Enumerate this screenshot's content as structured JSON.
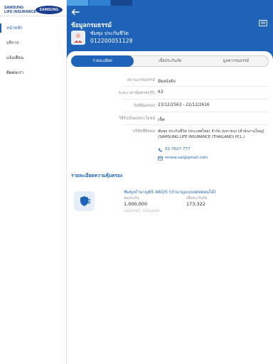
{
  "brand": {
    "line1": "SAMSUNG",
    "line2": "LIFE INSURANCE",
    "badge": "SAMSUNG",
    "color_primary": "#1f63b8",
    "color_logo": "#1a3d8f"
  },
  "sidebar": {
    "items": [
      {
        "label": "หน้าหลัก",
        "active": true
      },
      {
        "label": "บริการ",
        "active": false
      },
      {
        "label": "แจ้งเตือน",
        "active": false
      },
      {
        "label": "ติดต่อเรา",
        "active": false
      }
    ]
  },
  "header": {
    "title": "ข้อมูลกรมธรรม์",
    "holder_name": "ซัมซุง ประกันชีวิต",
    "policy_number": "012200051128",
    "back_icon": "arrow-left-icon",
    "card_icon": "id-card-icon"
  },
  "tabs": [
    {
      "label": "รายละเอียด",
      "active": true
    },
    {
      "label": "เบี้ยประกันภัย",
      "active": false
    },
    {
      "label": "มูลค่ากรมธรรม์",
      "active": false
    }
  ],
  "details": [
    {
      "label": "สถานะกรมธรรม์",
      "value": "มีผลบังคับ"
    },
    {
      "label": "ระยะเวลาคุ้มครอง(ปี)",
      "value": "63"
    },
    {
      "label": "วันที่คุ้มครอง",
      "value": "23/12/2563 - 22/12/2616"
    },
    {
      "label": "วิธีรับเงินผลประโยชน์",
      "value": "เช็ค"
    },
    {
      "label": "บริษัทที่ติดต่อ",
      "value_line1": "ซัมซุง ประกันชีวิต (ประเทศไทย) จำกัด (มหาชน) (สำนักงานใหญ่)",
      "value_line2": "(SAMSUNG LIFE INSURANCE (THAILAND) PCL.)"
    }
  ],
  "contact": {
    "phone": "02-7627-777",
    "email": "renew.sal@gmail.com",
    "phone_icon": "phone-icon",
    "email_icon": "email-icon"
  },
  "coverage": {
    "section_title": "รายละเอียดความคุ้มครอง",
    "icon": "shield-coverage-icon",
    "name": "ซัมซุงบำนาญ65 A60/5 (บำนาญแบบลดหย่อนได้)",
    "sum_label": "ทุนประกัน",
    "sum_value": "1,000,000",
    "premium_label": "เบี้ยประกันภัย",
    "premium_value": "173,322",
    "period": "23/12/2563 - 22/12/2616"
  }
}
